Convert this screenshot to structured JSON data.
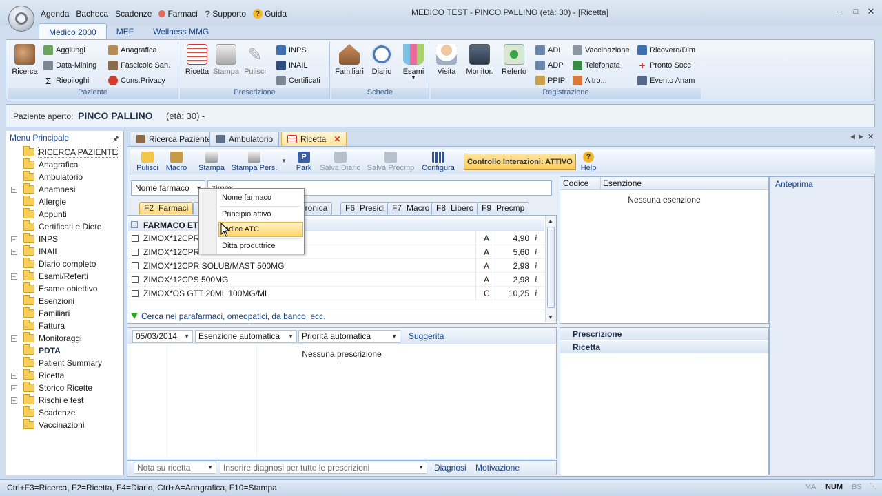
{
  "window": {
    "title": "MEDICO TEST - PINCO PALLINO (età: 30)   - [Ricetta]",
    "quick_access": [
      "Agenda",
      "Bacheca",
      "Scadenze",
      "Farmaci",
      "Supporto",
      "Guida"
    ]
  },
  "ribbon": {
    "tabs": [
      "Medico 2000",
      "MEF",
      "Wellness MMG"
    ],
    "active_tab": "Medico 2000",
    "groups": {
      "paziente": {
        "label": "Paziente",
        "big": "Ricerca",
        "col1": [
          "Aggiungi",
          "Data-Mining",
          "Riepiloghi"
        ],
        "col2": [
          "Anagrafica",
          "Fascicolo San.",
          "Cons.Privacy"
        ]
      },
      "prescrizione": {
        "label": "Prescrizione",
        "big": [
          "Ricetta",
          "Stampa",
          "Pulisci"
        ],
        "col1": [
          "INPS",
          "INAIL",
          "Certificati"
        ]
      },
      "schede": {
        "label": "Schede",
        "big": [
          "Familiari",
          "Diario",
          "Esami"
        ]
      },
      "registrazione": {
        "label": "Registrazione",
        "big": [
          "Visita",
          "Monitor.",
          "Referto"
        ],
        "col1": [
          "ADI",
          "ADP",
          "PPIP"
        ],
        "col2": [
          "Vaccinazione",
          "Telefonata",
          "Altro..."
        ],
        "col3": [
          "Ricovero/Dim",
          "Pronto Socc",
          "Evento Anam"
        ]
      }
    }
  },
  "patient_bar": {
    "label": "Paziente aperto:",
    "name": "PINCO PALLINO",
    "age": "(età: 30) -"
  },
  "left_menu": {
    "title": "Menu Principale",
    "items": [
      {
        "label": "RICERCA PAZIENTE",
        "expandable": false
      },
      {
        "label": "Anagrafica",
        "expandable": false
      },
      {
        "label": "Ambulatorio",
        "expandable": false
      },
      {
        "label": "Anamnesi",
        "expandable": true
      },
      {
        "label": "Allergie",
        "expandable": false
      },
      {
        "label": "Appunti",
        "expandable": false
      },
      {
        "label": "Certificati e Diete",
        "expandable": false
      },
      {
        "label": "INPS",
        "expandable": true
      },
      {
        "label": "INAIL",
        "expandable": true
      },
      {
        "label": "Diario completo",
        "expandable": false
      },
      {
        "label": "Esami/Referti",
        "expandable": true
      },
      {
        "label": "Esame obiettivo",
        "expandable": false
      },
      {
        "label": "Esenzioni",
        "expandable": false
      },
      {
        "label": "Familiari",
        "expandable": false
      },
      {
        "label": "Fattura",
        "expandable": false
      },
      {
        "label": "Monitoraggi",
        "expandable": true
      },
      {
        "label": "PDTA",
        "expandable": false
      },
      {
        "label": "Patient Summary",
        "expandable": false
      },
      {
        "label": "Ricetta",
        "expandable": true
      },
      {
        "label": "Storico Ricette",
        "expandable": true
      },
      {
        "label": "Rischi e test",
        "expandable": true
      },
      {
        "label": "Scadenze",
        "expandable": false
      },
      {
        "label": "Vaccinazioni",
        "expandable": false
      }
    ]
  },
  "doc_tabs": [
    "Ricerca Paziente",
    "Ambulatorio",
    "Ricetta"
  ],
  "active_doc_tab": "Ricetta",
  "toolbar": {
    "buttons": [
      "Pulisci",
      "Macro",
      "Stampa",
      "Stampa Pers.",
      "Park",
      "Salva Diario",
      "Salva Precmp",
      "Configura"
    ],
    "interaction_control": "Controllo Interazioni: ATTIVO",
    "help": "Help"
  },
  "search": {
    "type_selected": "Nome farmaco",
    "query": "zimox"
  },
  "function_tabs": [
    "F2=Farmaci",
    "F4=",
    "F5=Cronica",
    "F6=Presidi",
    "F7=Macro",
    "F8=Libero",
    "F9=Precmp"
  ],
  "function_tab_labels": {
    "t0": "F2=Farmaci",
    "t2": "=Cronica",
    "t3": "F6=Presidi",
    "t4": "F7=Macro",
    "t5": "F8=Libero",
    "t6": "F9=Precmp"
  },
  "drug_grid": {
    "group_header": "FARMACO ETI",
    "rows": [
      {
        "name": "ZIMOX*12CPR",
        "class": "A",
        "price": "4,90"
      },
      {
        "name": "ZIMOX*12CPR",
        "class": "A",
        "price": "5,60"
      },
      {
        "name": "ZIMOX*12CPR SOLUB/MAST 500MG",
        "class": "A",
        "price": "2,98"
      },
      {
        "name": "ZIMOX*12CPS 500MG",
        "class": "A",
        "price": "2,98"
      },
      {
        "name": "ZIMOX*OS GTT 20ML 100MG/ML",
        "class": "C",
        "price": "10,25"
      }
    ],
    "footer_link": "Cerca nei parafarmaci, omeopatici, da banco, ecc."
  },
  "dropdown": {
    "options": [
      "Nome farmaco",
      "Principio attivo",
      "Codice ATC",
      "Ditta produttrice"
    ],
    "highlighted": "Codice ATC",
    "highlighted_display": "odice ATC"
  },
  "prescription": {
    "date": "05/03/2014",
    "exemption": "Esenzione automatica",
    "priority": "Priorità automatica",
    "suggested": "Suggerita",
    "empty_text": "Nessuna prescrizione",
    "note_placeholder": "Nota su ricetta",
    "diagnosis_placeholder": "Inserire diagnosi per tutte le prescrizioni",
    "diagnosi": "Diagnosi",
    "motivazione": "Motivazione"
  },
  "exemptions_panel": {
    "col_code": "Codice",
    "col_exemption": "Esenzione",
    "empty_text": "Nessuna esenzione"
  },
  "preview_label": "Anteprima",
  "summary_rows": [
    "Prescrizione",
    "Ricetta"
  ],
  "status_bar": {
    "shortcuts": "Ctrl+F3=Ricerca, F2=Ricetta, F4=Diario, Ctrl+A=Anagrafica, F10=Stampa",
    "indicators": [
      "MA",
      "NUM",
      "BS"
    ],
    "active_indicator": "NUM"
  },
  "colors": {
    "ribbon_blue": "#15428b",
    "highlight_yellow": "#ffd46a",
    "frame_blue": "#9ab3d5"
  }
}
